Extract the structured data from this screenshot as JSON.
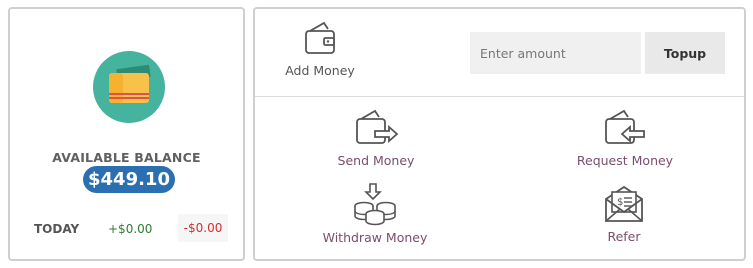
{
  "balance": {
    "label": "AVAILABLE BALANCE",
    "amount": "$449.10",
    "today_label": "TODAY",
    "today_in": "+$0.00",
    "today_out": "-$0.00",
    "icon": "wallet-icon"
  },
  "add_money": {
    "label": "Add Money",
    "icon": "wallet-outline-icon",
    "input_placeholder": "Enter amount",
    "input_value": "",
    "button_label": "Topup"
  },
  "actions": [
    {
      "label": "Send Money",
      "icon": "send-money-icon"
    },
    {
      "label": "Request Money",
      "icon": "request-money-icon"
    },
    {
      "label": "Withdraw Money",
      "icon": "withdraw-coins-icon"
    },
    {
      "label": "Refer",
      "icon": "refer-envelope-icon"
    }
  ],
  "colors": {
    "accent_blue": "#2c6fb0",
    "wallet_circle": "#45b39d",
    "wallet_body": "#f8c24a",
    "positive": "#2e7d32",
    "negative": "#d32f2f",
    "action_label": "#7a4e6e"
  }
}
